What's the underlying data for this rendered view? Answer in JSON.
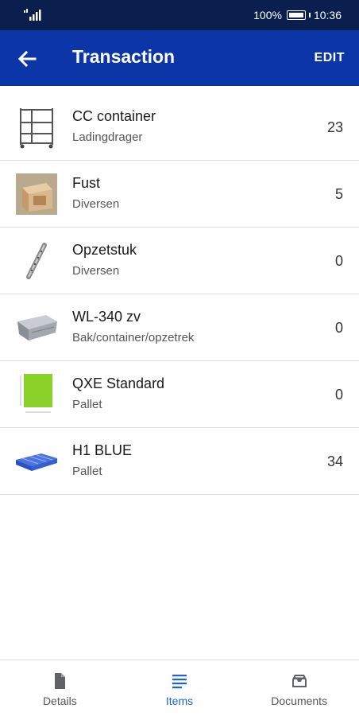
{
  "status_bar": {
    "battery_text": "100%",
    "time": "10:36",
    "signal_icon": "signal-icon",
    "battery_icon": "battery-icon"
  },
  "app_bar": {
    "title": "Transaction",
    "edit_label": "EDIT",
    "back_icon": "arrow-left-icon",
    "background": "#0c35a8"
  },
  "items": [
    {
      "name": "CC container",
      "category": "Ladingdrager",
      "quantity": "23",
      "image": "cc-container-thumbnail"
    },
    {
      "name": "Fust",
      "category": "Diversen",
      "quantity": "5",
      "image": "crate-thumbnail"
    },
    {
      "name": "Opzetstuk",
      "category": "Diversen",
      "quantity": "0",
      "image": "shelf-rail-thumbnail"
    },
    {
      "name": "WL-340 zv",
      "category": "Bak/container/opzetrek",
      "quantity": "0",
      "image": "grey-bin-thumbnail"
    },
    {
      "name": "QXE Standard",
      "category": "Pallet",
      "quantity": "0",
      "image": "green-pallet-thumbnail"
    },
    {
      "name": "H1 BLUE",
      "category": "Pallet",
      "quantity": "34",
      "image": "blue-pallet-thumbnail"
    }
  ],
  "bottom_nav": {
    "tabs": [
      {
        "label": "Details",
        "icon": "document-icon",
        "active": false
      },
      {
        "label": "Items",
        "icon": "list-icon",
        "active": true
      },
      {
        "label": "Documents",
        "icon": "inbox-tray-icon",
        "active": false
      }
    ],
    "active_color": "#1f63d8"
  }
}
